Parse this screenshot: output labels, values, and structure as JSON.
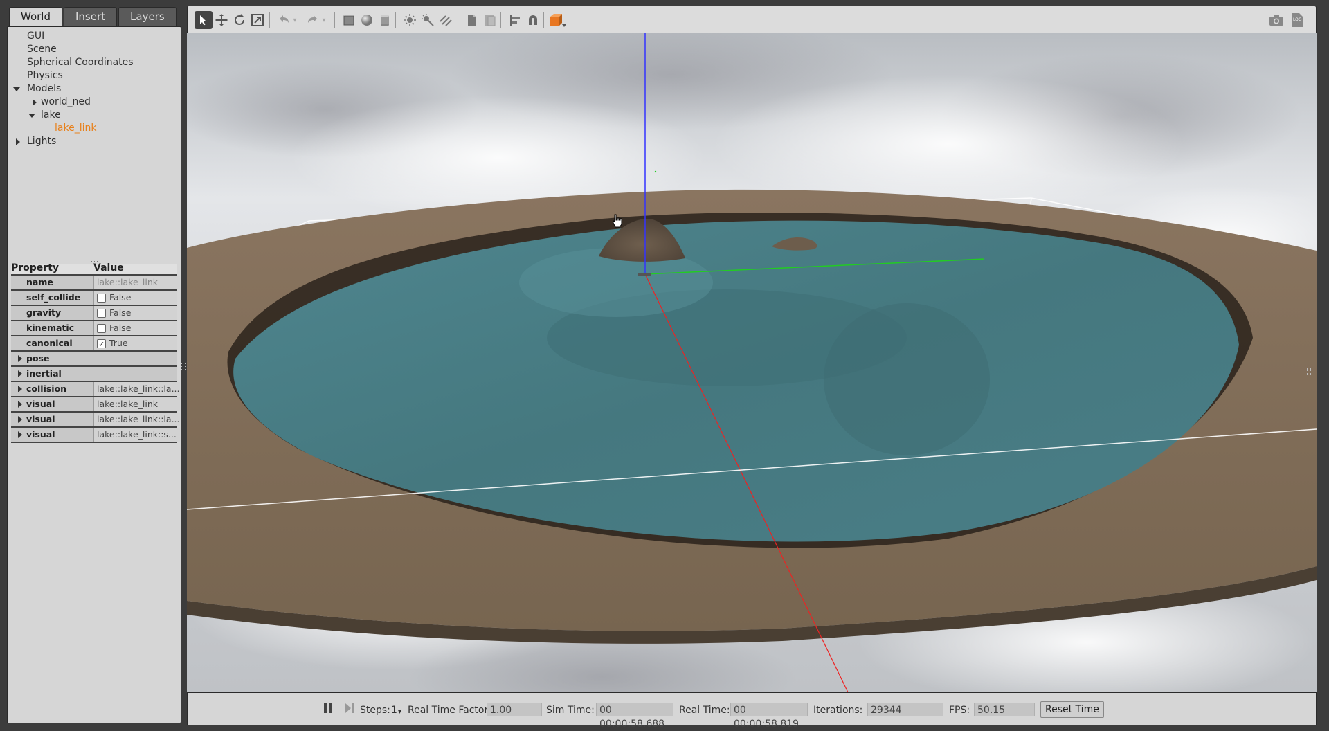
{
  "tabs": [
    {
      "label": "World"
    },
    {
      "label": "Insert"
    },
    {
      "label": "Layers"
    }
  ],
  "tree": {
    "gui": "GUI",
    "scene": "Scene",
    "spherical": "Spherical Coordinates",
    "physics": "Physics",
    "models": "Models",
    "world_ned": "world_ned",
    "lake": "lake",
    "lake_link": "lake_link",
    "lights": "Lights"
  },
  "props": {
    "header_property": "Property",
    "header_value": "Value",
    "name_key": "name",
    "name_val": "lake::lake_link",
    "self_collide_key": "self_collide",
    "self_collide_val": "False",
    "gravity_key": "gravity",
    "gravity_val": "False",
    "kinematic_key": "kinematic",
    "kinematic_val": "False",
    "canonical_key": "canonical",
    "canonical_val": "True",
    "pose_key": "pose",
    "inertial_key": "inertial",
    "collision_key": "collision",
    "collision_val": "lake::lake_link::la...",
    "visual1_key": "visual",
    "visual1_val": "lake::lake_link",
    "visual2_key": "visual",
    "visual2_val": "lake::lake_link::la...",
    "visual3_key": "visual",
    "visual3_val": "lake::lake_link::s..."
  },
  "toolbar": {
    "icons": [
      "select-arrow-icon",
      "translate-icon",
      "rotate-icon",
      "scale-icon",
      "undo-icon",
      "redo-icon",
      "box-icon",
      "sphere-icon",
      "cylinder-icon",
      "point-light-icon",
      "spot-light-icon",
      "directional-light-icon",
      "copy-icon",
      "paste-icon",
      "align-icon",
      "snap-magnet-icon",
      "view-angle-icon",
      "screenshot-icon",
      "log-icon"
    ]
  },
  "status": {
    "steps_label": "Steps:",
    "steps_value": "1",
    "rtf_label": "Real Time Factor:",
    "rtf_value": "1.00",
    "sim_label": "Sim Time:",
    "sim_value": "00 00:00:58.688",
    "real_label": "Real Time:",
    "real_value": "00 00:00:58.819",
    "iter_label": "Iterations:",
    "iter_value": "29344",
    "fps_label": "FPS:",
    "fps_value": "50.15",
    "reset_label": "Reset Time"
  },
  "colors": {
    "water": "#4a7f88",
    "terrain": "#8e7a62",
    "selected": "#e8811c"
  }
}
